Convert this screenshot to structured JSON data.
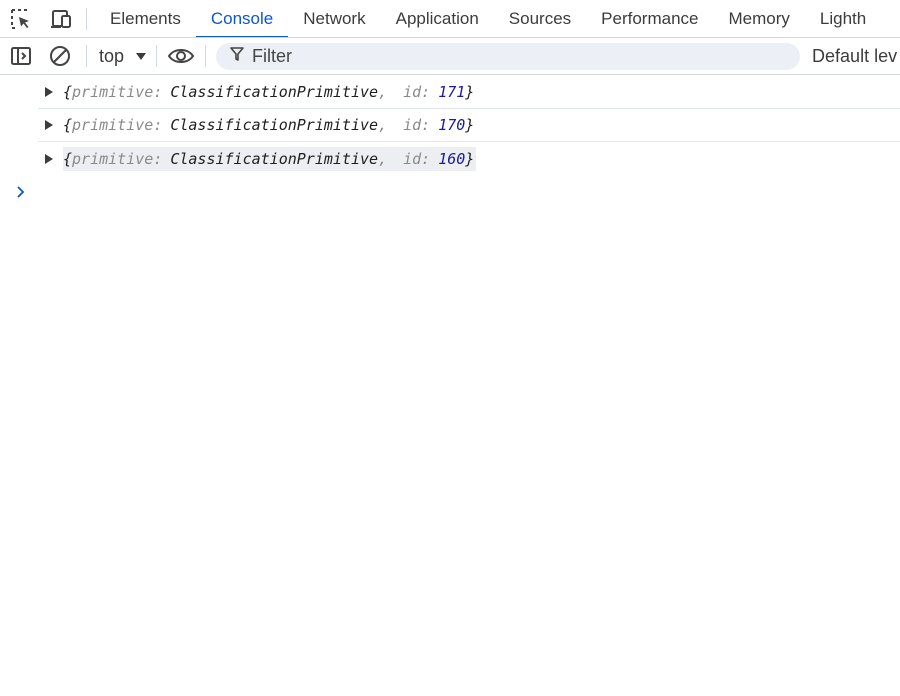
{
  "tabbar": {
    "icons": [
      "inspect-element-icon",
      "device-toolbar-icon"
    ],
    "tabs": [
      {
        "label": "Elements",
        "active": false
      },
      {
        "label": "Console",
        "active": true
      },
      {
        "label": "Network",
        "active": false
      },
      {
        "label": "Application",
        "active": false
      },
      {
        "label": "Sources",
        "active": false
      },
      {
        "label": "Performance",
        "active": false
      },
      {
        "label": "Memory",
        "active": false
      },
      {
        "label": "Lighth",
        "active": false
      }
    ]
  },
  "toolbar": {
    "context": "top",
    "filter_placeholder": "Filter",
    "levels": "Default lev"
  },
  "console": {
    "messages": [
      {
        "key1": "primitive",
        "value1": "ClassificationPrimitive",
        "key2": "id",
        "value2": "171"
      },
      {
        "key1": "primitive",
        "value1": "ClassificationPrimitive",
        "key2": "id",
        "value2": "170"
      },
      {
        "key1": "primitive",
        "value1": "ClassificationPrimitive",
        "key2": "id",
        "value2": "160"
      }
    ],
    "prompt_icon": "chevron-right-icon"
  },
  "colors": {
    "accent": "#0b57d0",
    "number": "#1a1aa6",
    "key": "#8a8a8a"
  }
}
